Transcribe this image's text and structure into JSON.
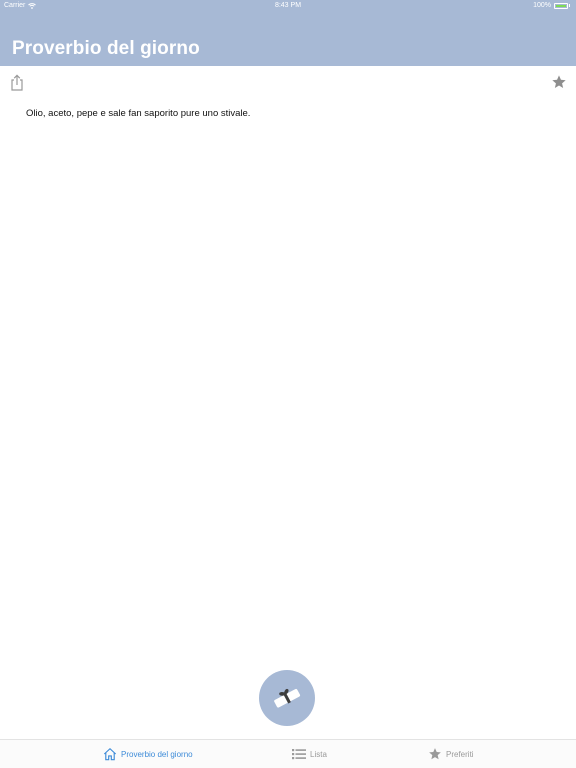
{
  "status_bar": {
    "carrier": "Carrier",
    "time": "8:43 PM",
    "battery": "100%",
    "battery_level": 1.0
  },
  "header": {
    "title": "Proverbio del giorno"
  },
  "toolbar": {
    "share_icon": "share-icon",
    "favorite_icon": "star-icon"
  },
  "proverb": {
    "text": "Olio, aceto, pepe e sale fan saporito pure uno stivale."
  },
  "fab": {
    "icon": "scroll-icon"
  },
  "tabs": [
    {
      "label": "Proverbio del giorno",
      "icon": "home-icon",
      "active": true
    },
    {
      "label": "Lista",
      "icon": "list-icon",
      "active": false
    },
    {
      "label": "Preferiti",
      "icon": "star-icon",
      "active": false
    }
  ],
  "colors": {
    "header": "#a7b9d5",
    "accent": "#3d8bd8",
    "inactive": "#9a9a9a"
  }
}
